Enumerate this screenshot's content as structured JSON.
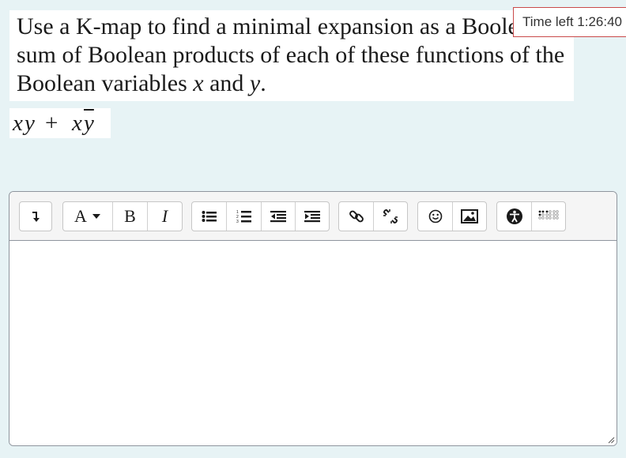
{
  "question": {
    "line1": "Use a K-map to find a minimal expansion as a Boolean",
    "line2": "sum of Boolean products of each of these functions of the",
    "line3_start": "Boolean variables ",
    "var_x": "x",
    "and_word": " and ",
    "var_y": "y",
    "line3_end": "."
  },
  "expression": {
    "t1": "x",
    "t2": "y",
    "plus": "+",
    "t3": "x",
    "t4": "y"
  },
  "timer": {
    "label": "Time left 1:26:40"
  },
  "toolbar": {
    "font_label": "A",
    "bold_label": "B",
    "italic_label": "I"
  },
  "icons": {
    "collapse": "collapse-icon",
    "font_color": "font-color-dropdown-icon",
    "bulleted_list": "bullet-list-icon",
    "numbered_list": "numbered-list-icon",
    "outdent": "outdent-icon",
    "indent": "indent-icon",
    "link": "link-icon",
    "unlink": "unlink-icon",
    "emoji": "smiley-icon",
    "image": "image-icon",
    "accessibility": "accessibility-icon",
    "braille": "screenreader-helper-icon",
    "resize": "resize-grip-icon"
  },
  "colors": {
    "page_bg": "#e7f3f5",
    "timer_border": "#c94a4a",
    "editor_border": "#8f959e"
  }
}
